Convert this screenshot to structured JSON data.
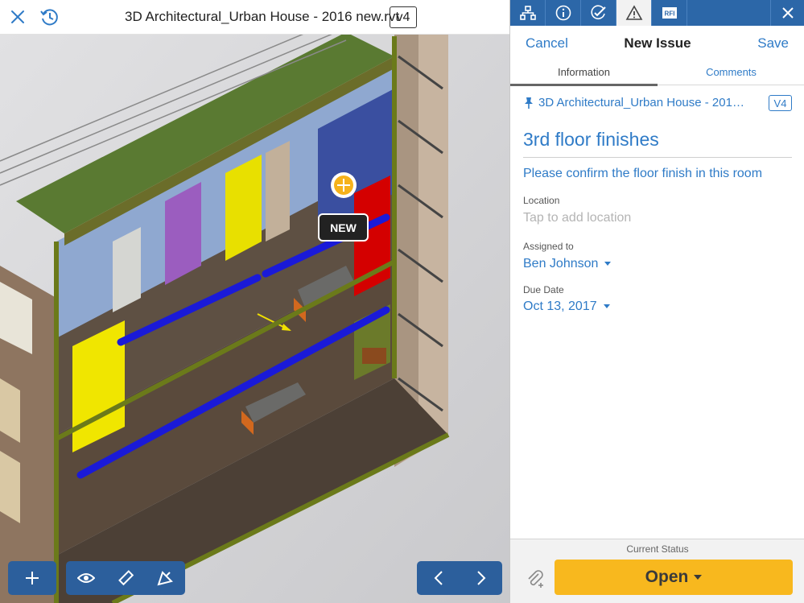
{
  "viewer": {
    "document_title": "3D Architectural_Urban House - 2016 new.rvt",
    "version_badge": "v4",
    "pin_label": "NEW",
    "icons": [
      "close-icon",
      "history-icon",
      "plus-icon",
      "eye-icon",
      "ruler-icon",
      "markup-icon",
      "chevron-left-icon",
      "chevron-right-icon"
    ]
  },
  "panel": {
    "tabs": [
      {
        "icon": "hierarchy-icon"
      },
      {
        "icon": "info-icon"
      },
      {
        "icon": "checklist-icon"
      },
      {
        "icon": "warning-icon"
      },
      {
        "icon": "rfi-icon",
        "label": "RFI"
      },
      {
        "icon": "close-icon"
      }
    ],
    "nav": {
      "cancel": "Cancel",
      "title": "New Issue",
      "save": "Save"
    },
    "segments": {
      "information": "Information",
      "comments": "Comments"
    },
    "file_name": "3D Architectural_Urban House - 2016 new.rvt",
    "file_version": "V4",
    "issue_title": "3rd floor finishes",
    "description": "Please confirm the floor finish in this room",
    "fields": {
      "location_label": "Location",
      "location_placeholder": "Tap to add location",
      "assigned_label": "Assigned to",
      "assigned_value": "Ben Johnson",
      "due_label": "Due Date",
      "due_value": "Oct 13, 2017"
    },
    "footer": {
      "status_label": "Current Status",
      "status_value": "Open"
    }
  },
  "colors": {
    "accent": "#2f7bc7",
    "tab_bar": "#2c67a8",
    "toolbar": "#2c5f9c",
    "status": "#f8b81e"
  }
}
